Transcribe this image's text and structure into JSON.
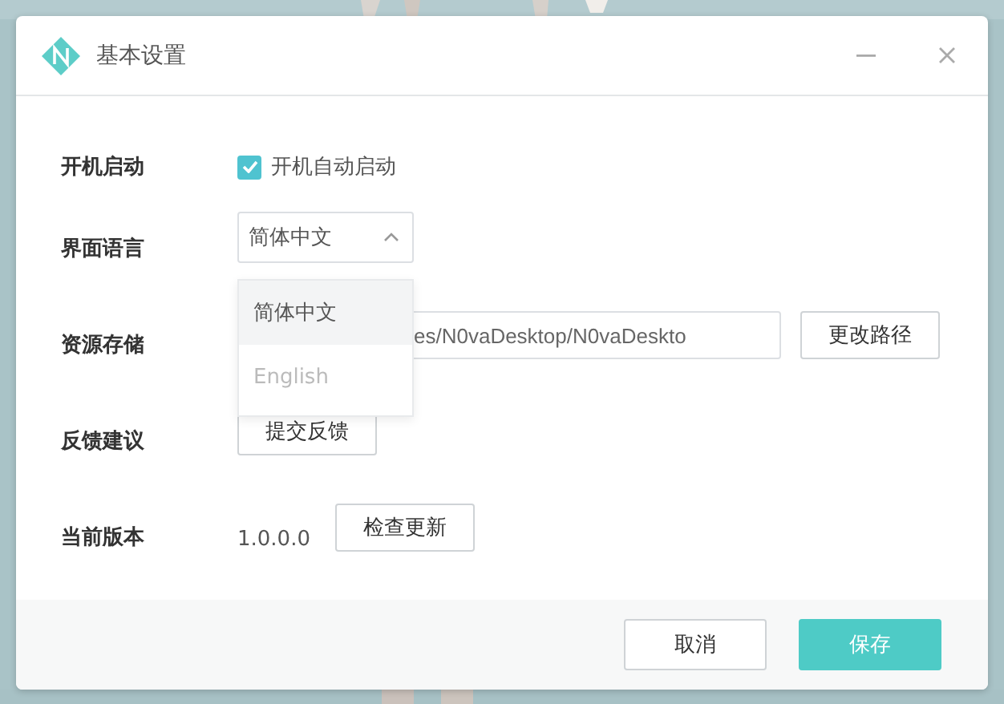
{
  "window": {
    "title": "基本设置"
  },
  "settings": [
    {
      "kind": "checkbox",
      "label": "开机启动",
      "text": "开机自动启动",
      "checked": true
    },
    {
      "kind": "select",
      "label": "界面语言",
      "value": "简体中文",
      "expanded": true,
      "options": [
        {
          "label": "简体中文",
          "selected": true
        },
        {
          "label": "English",
          "selected": false
        }
      ]
    },
    {
      "kind": "path",
      "label": "资源存储",
      "value": "es/N0vaDesktop/N0vaDeskto",
      "button": "更改路径"
    },
    {
      "kind": "button",
      "label": "反馈建议",
      "button": "提交反馈"
    },
    {
      "kind": "version",
      "label": "当前版本",
      "value": "1.0.0.0",
      "button": "检查更新"
    }
  ],
  "buttons": [
    {
      "label": "取消",
      "primary": false
    },
    {
      "label": "保存",
      "primary": true
    }
  ]
}
